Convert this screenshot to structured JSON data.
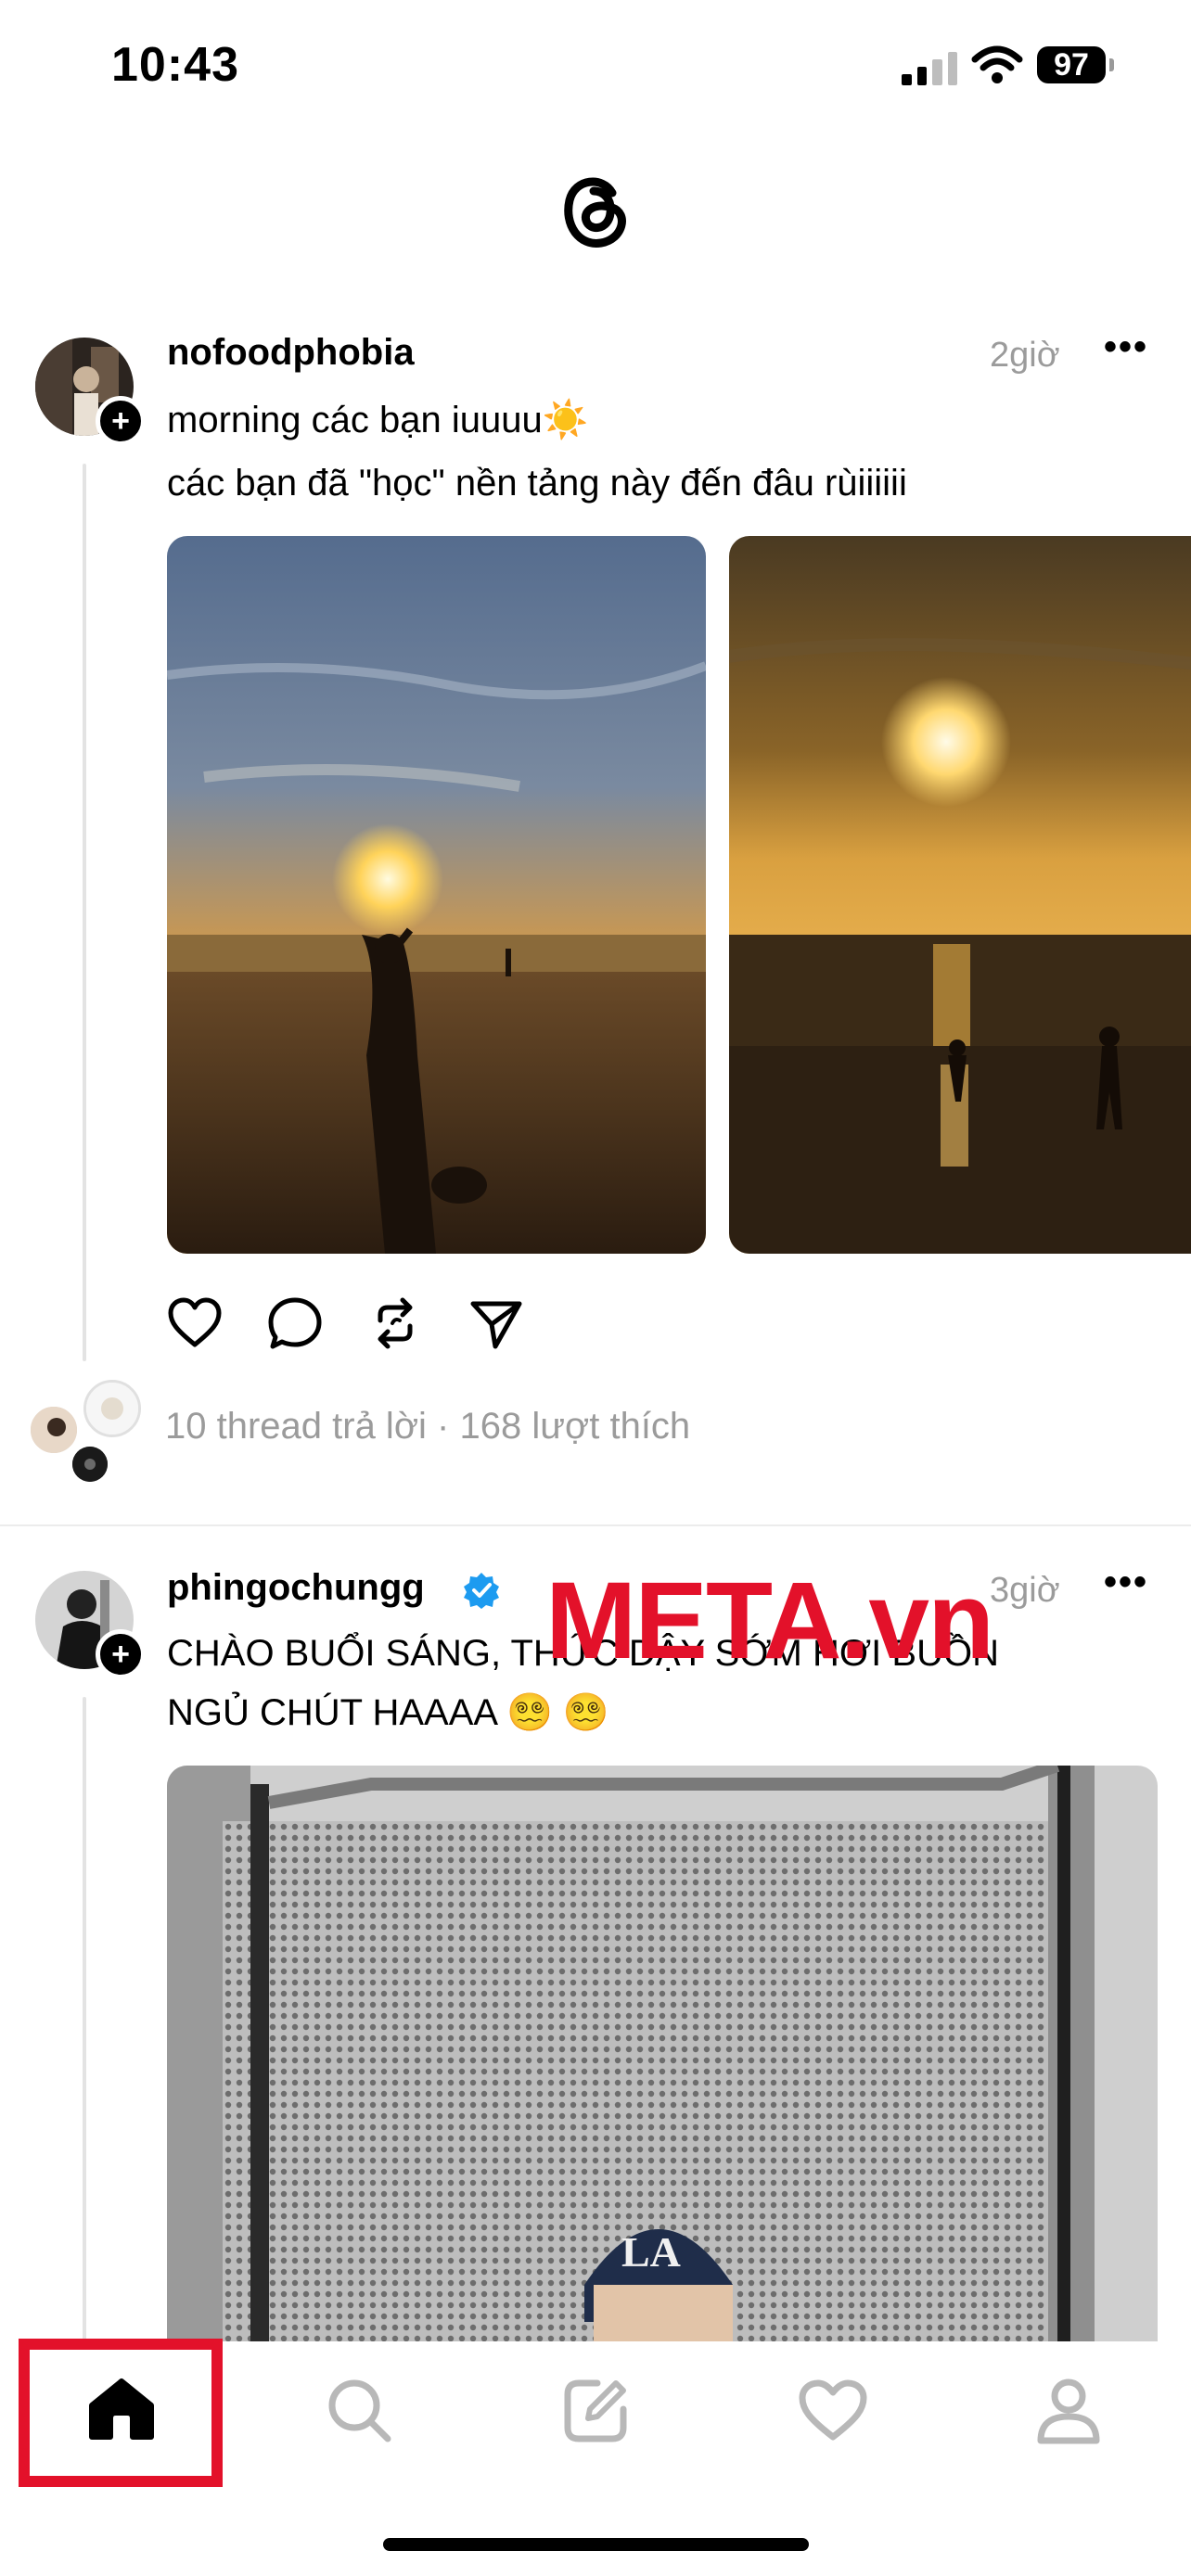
{
  "status_bar": {
    "time": "10:43",
    "battery": "97"
  },
  "posts": [
    {
      "username": "nofoodphobia",
      "time": "2giờ",
      "text_line1": "morning các bạn iuuuu☀️",
      "text_line2": "các bạn đã \"học\" nền tảng này đến đâu rùiiiiii",
      "stats": "10 thread trả lời · 168 lượt thích"
    },
    {
      "username": "phingochungg",
      "time": "3giờ",
      "text_line1": "CHÀO BUỔI SÁNG, THỨC DẬY SỚM HƠI BUỒN",
      "text_line2": "NGỦ CHÚT HAAAA 😵‍💫 😵‍💫"
    }
  ],
  "watermark": "META.vn",
  "nav": {
    "items": [
      "home-icon",
      "search-icon",
      "compose-icon",
      "activity-heart-icon",
      "profile-icon"
    ],
    "active": "home-icon",
    "highlight_color": "#e3112a"
  },
  "colors": {
    "verified": "#1d9bf0",
    "muted_text": "#9b9b9b"
  }
}
